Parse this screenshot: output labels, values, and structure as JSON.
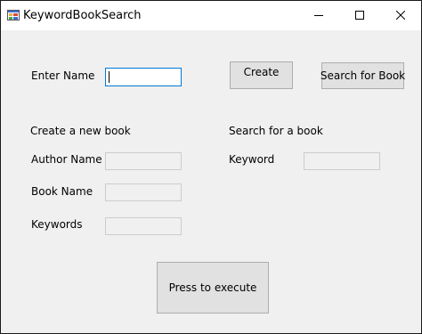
{
  "window": {
    "title": "KeywordBookSearch",
    "controls": {
      "minimize_icon": "minimize-icon",
      "maximize_icon": "maximize-icon",
      "close_icon": "close-icon"
    }
  },
  "form": {
    "enter_name_label": "Enter Name",
    "enter_name_value": "",
    "create_button": "Create",
    "search_for_book_button": "Search for Book",
    "create_section_title": "Create a new book",
    "search_section_title": "Search for a book",
    "author_name_label": "Author Name",
    "author_name_value": "",
    "book_name_label": "Book  Name",
    "book_name_value": "",
    "keywords_label": "Keywords",
    "keywords_value": "",
    "keyword_label": "Keyword",
    "keyword_value": "",
    "execute_button": "Press to execute"
  },
  "colors": {
    "accent": "#0078d7",
    "client_background": "#f0f0f0",
    "button_face": "#e1e1e1"
  }
}
